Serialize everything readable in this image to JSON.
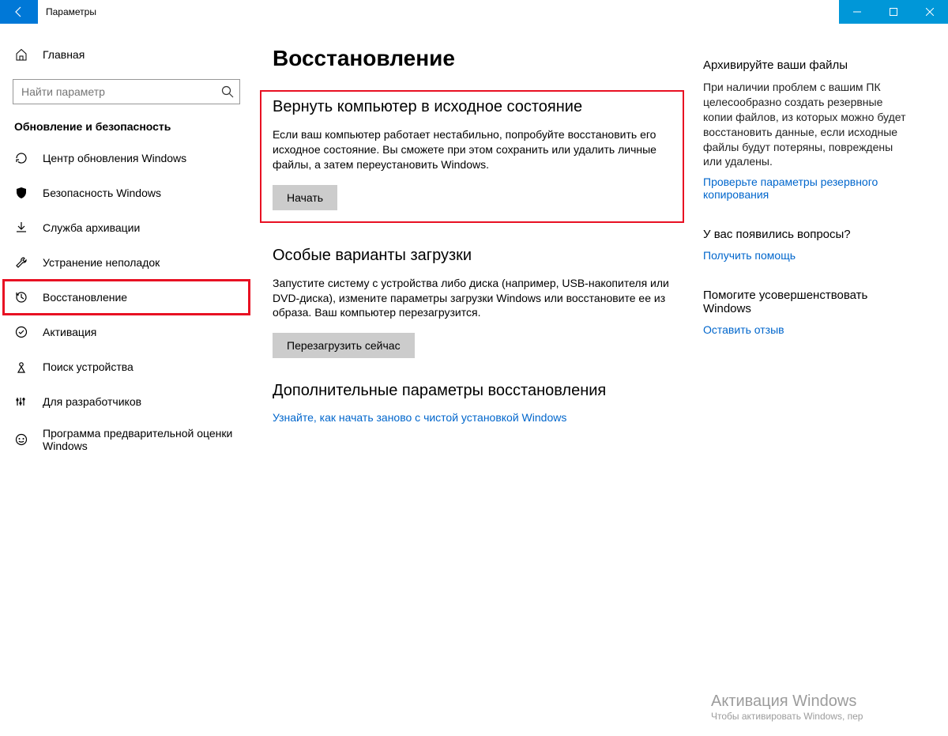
{
  "titlebar": {
    "title": "Параметры"
  },
  "sidebar": {
    "home": "Главная",
    "search_placeholder": "Найти параметр",
    "group_title": "Обновление и безопасность",
    "items": [
      {
        "label": "Центр обновления Windows"
      },
      {
        "label": "Безопасность Windows"
      },
      {
        "label": "Служба архивации"
      },
      {
        "label": "Устранение неполадок"
      },
      {
        "label": "Восстановление"
      },
      {
        "label": "Активация"
      },
      {
        "label": "Поиск устройства"
      },
      {
        "label": "Для разработчиков"
      },
      {
        "label": "Программа предварительной оценки Windows"
      }
    ]
  },
  "content": {
    "page_title": "Восстановление",
    "reset": {
      "heading": "Вернуть компьютер в исходное состояние",
      "desc": "Если ваш компьютер работает нестабильно, попробуйте восстановить его исходное состояние. Вы сможете при этом сохранить или удалить личные файлы, а затем переустановить Windows.",
      "button": "Начать"
    },
    "advanced_startup": {
      "heading": "Особые варианты загрузки",
      "desc": "Запустите систему с устройства либо диска (например, USB-накопителя или DVD-диска), измените параметры загрузки Windows или восстановите ее из образа. Ваш компьютер перезагрузится.",
      "button": "Перезагрузить сейчас"
    },
    "more_recovery": {
      "heading": "Дополнительные параметры восстановления",
      "link": "Узнайте, как начать заново с чистой установкой Windows"
    }
  },
  "aside": {
    "backup": {
      "heading": "Архивируйте ваши файлы",
      "desc": "При наличии проблем с вашим ПК целесообразно создать резервные копии файлов, из которых можно будет восстановить данные, если исходные файлы будут потеряны, повреждены или удалены.",
      "link": "Проверьте параметры резервного копирования"
    },
    "questions": {
      "heading": "У вас появились вопросы?",
      "link": "Получить помощь"
    },
    "feedback": {
      "heading": "Помогите усовершенствовать Windows",
      "link": "Оставить отзыв"
    }
  },
  "watermark": {
    "line1": "Активация Windows",
    "line2": "Чтобы активировать Windows, пер"
  }
}
